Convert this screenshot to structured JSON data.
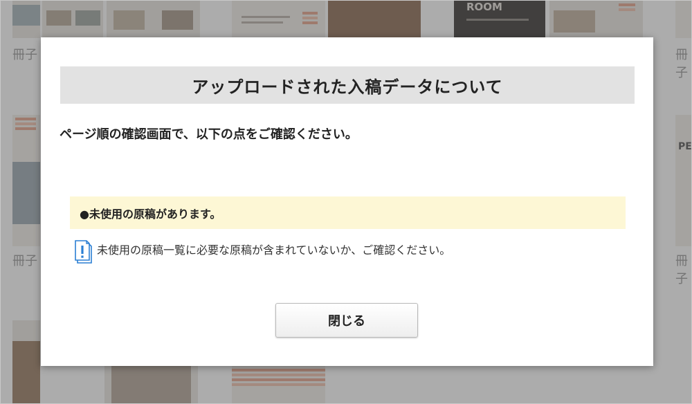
{
  "background": {
    "thumb_labels": [
      "冊子",
      "冊子",
      "冊子",
      "冊子"
    ],
    "thumb_text": {
      "room_heading": "ROOM",
      "pe_heading": "PE"
    }
  },
  "modal": {
    "title": "アップロードされた入稿データについて",
    "instruction": "ページ順の確認画面で、以下の点をご確認ください。",
    "notice": {
      "title": "●未使用の原稿があります。",
      "icon": "document-alert-icon",
      "text": "未使用の原稿一覧に必要な原稿が含まれていないか、ご確認ください。"
    },
    "close_label": "閉じる"
  },
  "colors": {
    "overlay": "#464646",
    "title_bar": "#e2e2e2",
    "notice_bg": "#fdf7d5",
    "icon_blue": "#2a7fd4"
  }
}
